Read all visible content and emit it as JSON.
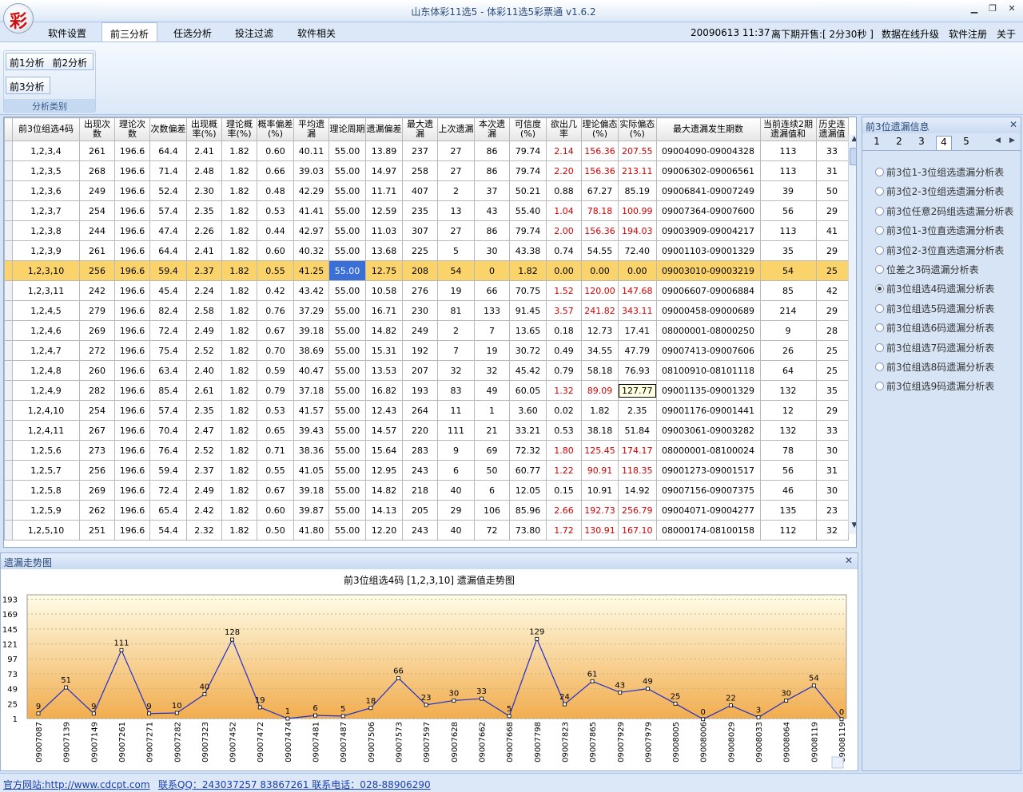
{
  "window": {
    "title": "山东体彩11选5 - 体彩11选5彩票通 v1.6.2",
    "logo_text": "彩"
  },
  "menu": {
    "items": [
      "软件设置",
      "前三分析",
      "任选分析",
      "投注过滤",
      "软件相关"
    ],
    "active_index": 1,
    "datetime": "20090613 11:37",
    "countdown": "离下期开售:[ 2分30秒 ]",
    "links": [
      "数据在线升级",
      "软件注册",
      "关于"
    ]
  },
  "ribbon": {
    "buttons": [
      "前1分析",
      "前2分析",
      "前3分析"
    ],
    "group_caption": "分析类别"
  },
  "grid": {
    "headers": [
      "前3位组选4码",
      "出现次数",
      "理论次数",
      "次数偏差",
      "出现概率(%)",
      "理论概率(%)",
      "概率偏差(%)",
      "平均遗漏",
      "理论周期",
      "遗漏偏差",
      "最大遗漏",
      "上次遗漏",
      "本次遗漏",
      "可信度(%)",
      "欲出几率",
      "理论偏态(%)",
      "实际偏态(%)",
      "最大遗漏发生期数",
      "当前连续2期遗漏值和",
      "历史连遗漏值"
    ],
    "rows": [
      [
        "1,2,3,4",
        "261",
        "196.6",
        "64.4",
        "2.41",
        "1.82",
        "0.60",
        "40.11",
        "55.00",
        "13.89",
        "237",
        "27",
        "86",
        "79.74",
        "2.14",
        "156.36",
        "207.55",
        "09004090-09004328",
        "113",
        "33"
      ],
      [
        "1,2,3,5",
        "268",
        "196.6",
        "71.4",
        "2.48",
        "1.82",
        "0.66",
        "39.03",
        "55.00",
        "14.97",
        "258",
        "27",
        "86",
        "79.74",
        "2.20",
        "156.36",
        "213.11",
        "09006302-09006561",
        "113",
        "31"
      ],
      [
        "1,2,3,6",
        "249",
        "196.6",
        "52.4",
        "2.30",
        "1.82",
        "0.48",
        "42.29",
        "55.00",
        "11.71",
        "407",
        "2",
        "37",
        "50.21",
        "0.88",
        "67.27",
        "85.19",
        "09006841-09007249",
        "39",
        "50"
      ],
      [
        "1,2,3,7",
        "254",
        "196.6",
        "57.4",
        "2.35",
        "1.82",
        "0.53",
        "41.41",
        "55.00",
        "12.59",
        "235",
        "13",
        "43",
        "55.40",
        "1.04",
        "78.18",
        "100.99",
        "09007364-09007600",
        "56",
        "29"
      ],
      [
        "1,2,3,8",
        "244",
        "196.6",
        "47.4",
        "2.26",
        "1.82",
        "0.44",
        "42.97",
        "55.00",
        "11.03",
        "307",
        "27",
        "86",
        "79.74",
        "2.00",
        "156.36",
        "194.03",
        "09003909-09004217",
        "113",
        "41"
      ],
      [
        "1,2,3,9",
        "261",
        "196.6",
        "64.4",
        "2.41",
        "1.82",
        "0.60",
        "40.32",
        "55.00",
        "13.68",
        "225",
        "5",
        "30",
        "43.38",
        "0.74",
        "54.55",
        "72.40",
        "09001103-09001329",
        "35",
        "29"
      ],
      [
        "1,2,3,10",
        "256",
        "196.6",
        "59.4",
        "2.37",
        "1.82",
        "0.55",
        "41.25",
        "55.00",
        "12.75",
        "208",
        "54",
        "0",
        "1.82",
        "0.00",
        "0.00",
        "0.00",
        "09003010-09003219",
        "54",
        "25"
      ],
      [
        "1,2,3,11",
        "242",
        "196.6",
        "45.4",
        "2.24",
        "1.82",
        "0.42",
        "43.42",
        "55.00",
        "10.58",
        "276",
        "19",
        "66",
        "70.75",
        "1.52",
        "120.00",
        "147.68",
        "09006607-09006884",
        "85",
        "42"
      ],
      [
        "1,2,4,5",
        "279",
        "196.6",
        "82.4",
        "2.58",
        "1.82",
        "0.76",
        "37.29",
        "55.00",
        "16.71",
        "230",
        "81",
        "133",
        "91.45",
        "3.57",
        "241.82",
        "343.11",
        "09000458-09000689",
        "214",
        "29"
      ],
      [
        "1,2,4,6",
        "269",
        "196.6",
        "72.4",
        "2.49",
        "1.82",
        "0.67",
        "39.18",
        "55.00",
        "14.82",
        "249",
        "2",
        "7",
        "13.65",
        "0.18",
        "12.73",
        "17.41",
        "08000001-08000250",
        "9",
        "28"
      ],
      [
        "1,2,4,7",
        "272",
        "196.6",
        "75.4",
        "2.52",
        "1.82",
        "0.70",
        "38.69",
        "55.00",
        "15.31",
        "192",
        "7",
        "19",
        "30.72",
        "0.49",
        "34.55",
        "47.79",
        "09007413-09007606",
        "26",
        "25"
      ],
      [
        "1,2,4,8",
        "260",
        "196.6",
        "63.4",
        "2.40",
        "1.82",
        "0.59",
        "40.47",
        "55.00",
        "13.53",
        "207",
        "32",
        "32",
        "45.42",
        "0.79",
        "58.18",
        "76.93",
        "08100910-08101118",
        "64",
        "25"
      ],
      [
        "1,2,4,9",
        "282",
        "196.6",
        "85.4",
        "2.61",
        "1.82",
        "0.79",
        "37.18",
        "55.00",
        "16.82",
        "193",
        "83",
        "49",
        "60.05",
        "1.32",
        "89.09",
        "127.77",
        "09001135-09001329",
        "132",
        "35"
      ],
      [
        "1,2,4,10",
        "254",
        "196.6",
        "57.4",
        "2.35",
        "1.82",
        "0.53",
        "41.57",
        "55.00",
        "12.43",
        "264",
        "11",
        "1",
        "3.60",
        "0.02",
        "1.82",
        "2.35",
        "09001176-09001441",
        "12",
        "29"
      ],
      [
        "1,2,4,11",
        "267",
        "196.6",
        "70.4",
        "2.47",
        "1.82",
        "0.65",
        "39.43",
        "55.00",
        "14.57",
        "220",
        "111",
        "21",
        "33.21",
        "0.53",
        "38.18",
        "51.84",
        "09003061-09003282",
        "132",
        "33"
      ],
      [
        "1,2,5,6",
        "273",
        "196.6",
        "76.4",
        "2.52",
        "1.82",
        "0.71",
        "38.36",
        "55.00",
        "15.64",
        "283",
        "9",
        "69",
        "72.32",
        "1.80",
        "125.45",
        "174.17",
        "08000001-08100024",
        "78",
        "30"
      ],
      [
        "1,2,5,7",
        "256",
        "196.6",
        "59.4",
        "2.37",
        "1.82",
        "0.55",
        "41.05",
        "55.00",
        "12.95",
        "243",
        "6",
        "50",
        "60.77",
        "1.22",
        "90.91",
        "118.35",
        "09001273-09001517",
        "56",
        "31"
      ],
      [
        "1,2,5,8",
        "269",
        "196.6",
        "72.4",
        "2.49",
        "1.82",
        "0.67",
        "39.18",
        "55.00",
        "14.82",
        "218",
        "40",
        "6",
        "12.05",
        "0.15",
        "10.91",
        "14.92",
        "09007156-09007375",
        "46",
        "30"
      ],
      [
        "1,2,5,9",
        "262",
        "196.6",
        "65.4",
        "2.42",
        "1.82",
        "0.60",
        "39.87",
        "55.00",
        "14.13",
        "205",
        "29",
        "106",
        "85.96",
        "2.66",
        "192.73",
        "256.79",
        "09004071-09004277",
        "135",
        "23"
      ],
      [
        "1,2,5,10",
        "251",
        "196.6",
        "54.4",
        "2.32",
        "1.82",
        "0.50",
        "41.80",
        "55.00",
        "12.20",
        "243",
        "40",
        "72",
        "73.80",
        "1.72",
        "130.91",
        "167.10",
        "08000174-08100158",
        "112",
        "32"
      ]
    ],
    "red_rows": [
      0,
      1,
      3,
      4,
      7,
      8,
      12,
      15,
      16,
      18,
      19
    ],
    "selected_row": 6
  },
  "side": {
    "title": "前3位遗漏信息",
    "tabs": [
      "1",
      "2",
      "3",
      "4",
      "5"
    ],
    "active_tab": 3,
    "options": [
      "前3位1-3位组选遗漏分析表",
      "前3位2-3位组选遗漏分析表",
      "前3位任意2码组选遗漏分析表",
      "前3位1-3位直选遗漏分析表",
      "前3位2-3位直选遗漏分析表",
      "位差之3码遗漏分析表",
      "前3位组选4码遗漏分析表",
      "前3位组选5码遗漏分析表",
      "前3位组选6码遗漏分析表",
      "前3位组选7码遗漏分析表",
      "前3位组选8码遗漏分析表",
      "前3位组选9码遗漏分析表"
    ],
    "selected_option": 6
  },
  "trend": {
    "panel_title": "遗漏走势图"
  },
  "chart_data": {
    "type": "line",
    "title": "前3位组选4码 [1,2,3,10] 遗漏值走势图",
    "y_tick_labels": [
      "1",
      "25",
      "49",
      "73",
      "97",
      "121",
      "145",
      "169",
      "193"
    ],
    "x": [
      "09007087",
      "09007139",
      "09007149",
      "09007261",
      "09007271",
      "09007282",
      "09007323",
      "09007452",
      "09007472",
      "09007474",
      "09007481",
      "09007487",
      "09007506",
      "09007573",
      "09007597",
      "09007628",
      "09007662",
      "09007668",
      "09007798",
      "09007823",
      "09007865",
      "09007929",
      "09007979",
      "09008005",
      "09008006",
      "09008029",
      "09008033",
      "09008064",
      "09008119",
      "09008119"
    ],
    "values": [
      9,
      51,
      9,
      111,
      9,
      10,
      40,
      128,
      19,
      1,
      6,
      5,
      18,
      66,
      23,
      30,
      33,
      5,
      129,
      24,
      61,
      43,
      49,
      25,
      0,
      22,
      3,
      30,
      54,
      0
    ],
    "ylim": [
      1,
      200
    ],
    "colors": {
      "line": "#1f2fcc",
      "bg_top": "#fffde8",
      "bg_bottom": "#f2ad4e"
    }
  },
  "status": {
    "site": "官方网站:http://www.cdcpt.com",
    "contact": "联系QQ：243037257 83867261 联系电话：028-88906290"
  }
}
